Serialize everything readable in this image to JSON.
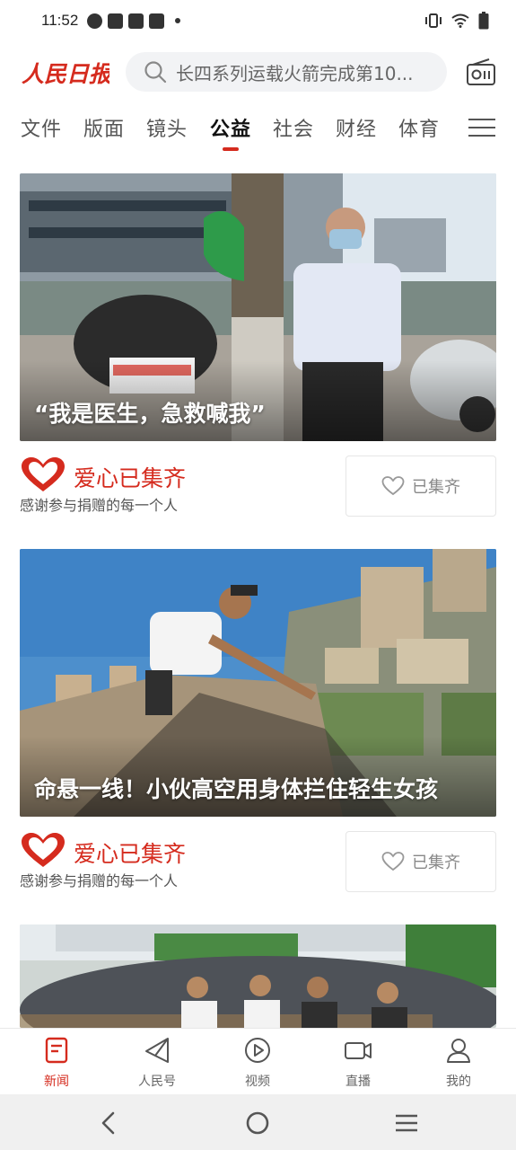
{
  "status_bar": {
    "time": "11:52",
    "left_icons": [
      "location-icon",
      "notification-icon",
      "notification-icon",
      "notification-icon",
      "dot-icon"
    ],
    "right_icons": [
      "vibrate-icon",
      "wifi-icon",
      "battery-icon"
    ]
  },
  "header": {
    "logo_text": "人民日报",
    "search_placeholder": "长四系列运载火箭完成第10..."
  },
  "channels": {
    "tabs": [
      {
        "label": "文件",
        "active": false
      },
      {
        "label": "版面",
        "active": false
      },
      {
        "label": "镜头",
        "active": false
      },
      {
        "label": "公益",
        "active": true
      },
      {
        "label": "社会",
        "active": false
      },
      {
        "label": "财经",
        "active": false
      },
      {
        "label": "体育",
        "active": false
      }
    ]
  },
  "cards": [
    {
      "caption": "“我是医生，急救喊我”",
      "donate_title": "爱心已集齐",
      "donate_sub": "感谢参与捐赠的每一个人",
      "button_label": "已集齐"
    },
    {
      "caption": "命悬一线！小伙高空用身体拦住轻生女孩",
      "donate_title": "爱心已集齐",
      "donate_sub": "感谢参与捐赠的每一个人",
      "button_label": "已集齐"
    },
    {
      "caption": "",
      "donate_title": "",
      "donate_sub": "",
      "button_label": ""
    }
  ],
  "bottom_nav": {
    "items": [
      {
        "label": "新闻",
        "icon": "news-icon",
        "active": true
      },
      {
        "label": "人民号",
        "icon": "paper-plane-icon",
        "active": false
      },
      {
        "label": "视频",
        "icon": "play-icon",
        "active": false
      },
      {
        "label": "直播",
        "icon": "camera-icon",
        "active": false
      },
      {
        "label": "我的",
        "icon": "person-icon",
        "active": false
      }
    ]
  },
  "colors": {
    "accent": "#d52b1e",
    "search_bg": "#f2f3f5",
    "text_muted": "#555555"
  }
}
